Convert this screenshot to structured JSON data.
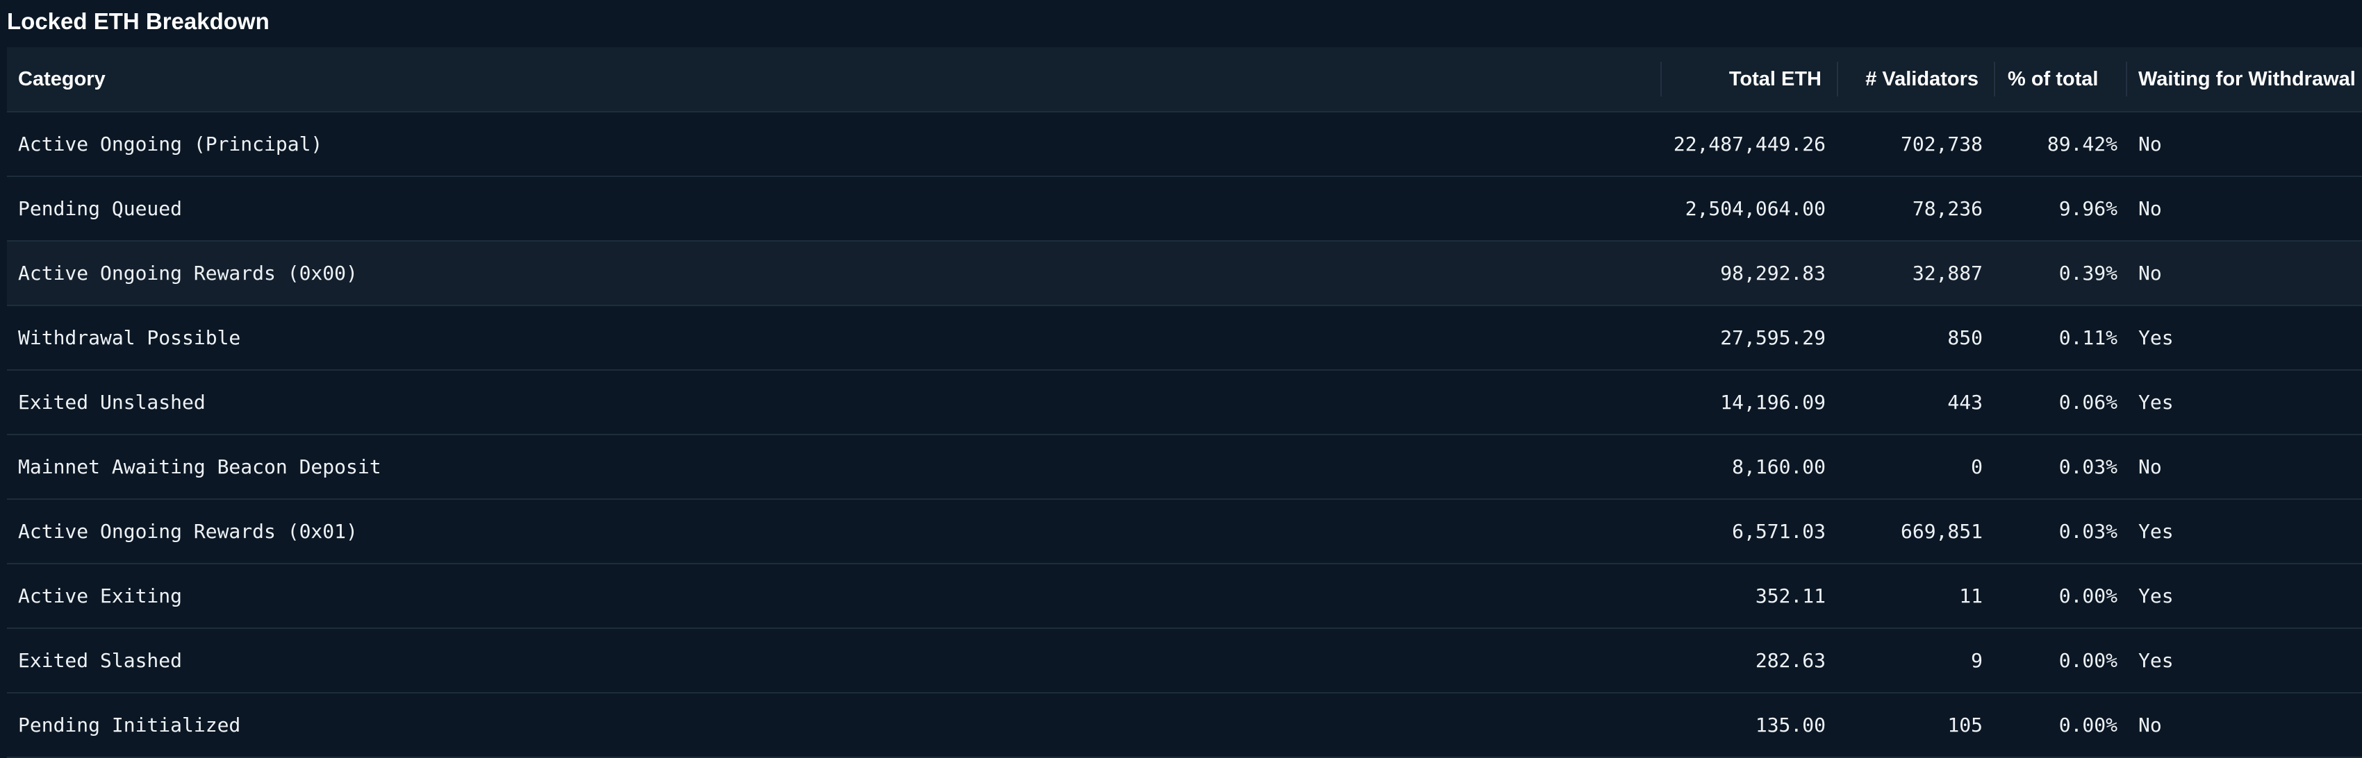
{
  "page": {
    "title": "Locked ETH Breakdown"
  },
  "table": {
    "columns": {
      "category": "Category",
      "total_eth": "Total ETH",
      "validators": "# Validators",
      "percent": "% of total",
      "waiting": "Waiting for Withdrawal"
    },
    "rows": [
      {
        "category": "Active Ongoing (Principal)",
        "total_eth": "22,487,449.26",
        "validators": "702,738",
        "percent": "89.42%",
        "waiting": "No"
      },
      {
        "category": "Pending Queued",
        "total_eth": "2,504,064.00",
        "validators": "78,236",
        "percent": "9.96%",
        "waiting": "No"
      },
      {
        "category": "Active Ongoing Rewards (0x00)",
        "total_eth": "98,292.83",
        "validators": "32,887",
        "percent": "0.39%",
        "waiting": "No"
      },
      {
        "category": "Withdrawal Possible",
        "total_eth": "27,595.29",
        "validators": "850",
        "percent": "0.11%",
        "waiting": "Yes"
      },
      {
        "category": "Exited Unslashed",
        "total_eth": "14,196.09",
        "validators": "443",
        "percent": "0.06%",
        "waiting": "Yes"
      },
      {
        "category": "Mainnet Awaiting Beacon Deposit",
        "total_eth": "8,160.00",
        "validators": "0",
        "percent": "0.03%",
        "waiting": "No"
      },
      {
        "category": "Active Ongoing Rewards (0x01)",
        "total_eth": "6,571.03",
        "validators": "669,851",
        "percent": "0.03%",
        "waiting": "Yes"
      },
      {
        "category": "Active Exiting",
        "total_eth": "352.11",
        "validators": "11",
        "percent": "0.00%",
        "waiting": "Yes"
      },
      {
        "category": "Exited Slashed",
        "total_eth": "282.63",
        "validators": "9",
        "percent": "0.00%",
        "waiting": "Yes"
      },
      {
        "category": "Pending Initialized",
        "total_eth": "135.00",
        "validators": "105",
        "percent": "0.00%",
        "waiting": "No"
      }
    ]
  },
  "colors": {
    "background": "#0b1724",
    "header_background": "#13202d",
    "hover_row_background": "#131f2c",
    "divider": "#1e2d3b",
    "text": "#eef2f6"
  }
}
